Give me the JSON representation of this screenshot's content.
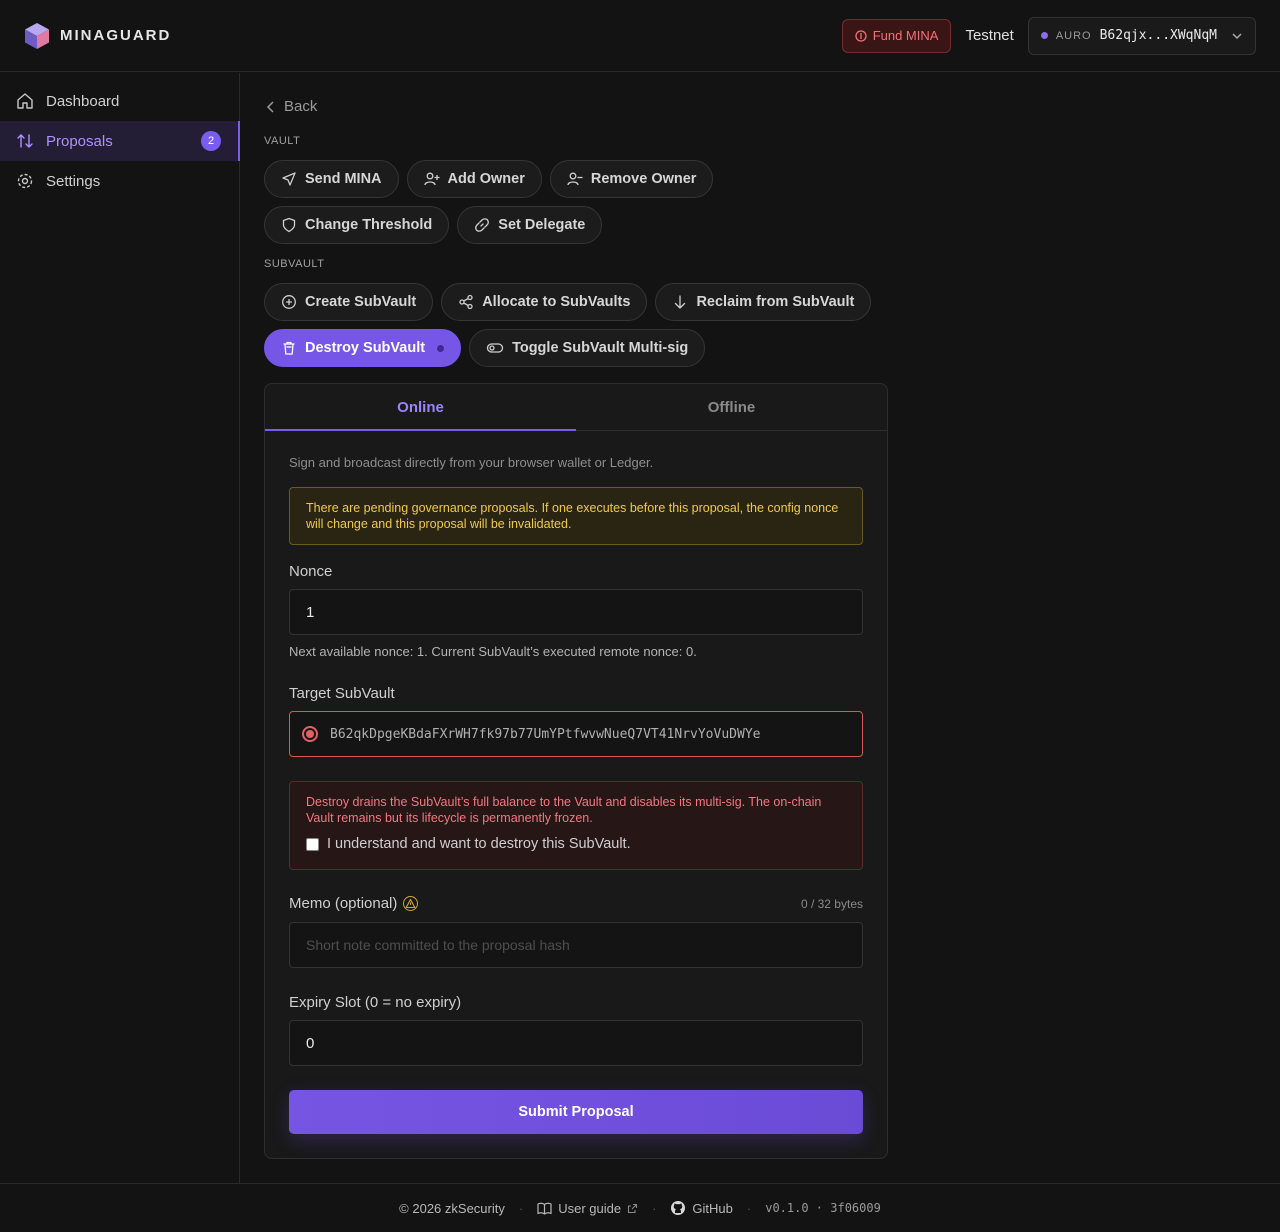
{
  "header": {
    "brand": "MINAGUARD",
    "fund_label": "Fund MINA",
    "network": "Testnet",
    "wallet_tag": "AURO",
    "wallet_address": "B62qjx...XWqNqM"
  },
  "sidebar": {
    "items": [
      {
        "label": "Dashboard"
      },
      {
        "label": "Proposals",
        "badge": "2"
      },
      {
        "label": "Settings"
      }
    ]
  },
  "main": {
    "back_label": "Back",
    "vault_section": "VAULT",
    "vault_actions": [
      "Send MINA",
      "Add Owner",
      "Remove Owner",
      "Change Threshold",
      "Set Delegate"
    ],
    "subvault_section": "SUBVAULT",
    "subvault_actions": [
      "Create SubVault",
      "Allocate to SubVaults",
      "Reclaim from SubVault",
      "Destroy SubVault",
      "Toggle SubVault Multi-sig"
    ]
  },
  "form": {
    "tabs": [
      "Online",
      "Offline"
    ],
    "hint": "Sign and broadcast directly from your browser wallet or Ledger.",
    "pending_warning": "There are pending governance proposals. If one executes before this proposal, the config nonce will change and this proposal will be invalidated.",
    "nonce_label": "Nonce",
    "nonce_value": "1",
    "nonce_hint": "Next available nonce: 1. Current SubVault’s executed remote nonce: 0.",
    "target_label": "Target SubVault",
    "target_value": "B62qkDpgeKBdaFXrWH7fk97b77UmYPtfwvwNueQ7VT41NrvYoVuDWYe",
    "destroy_warning": "Destroy drains the SubVault’s full balance to the Vault and disables its multi-sig. The on-chain Vault remains but its lifecycle is permanently frozen.",
    "confirm_label": "I understand and want to destroy this SubVault.",
    "memo_label": "Memo (optional)",
    "memo_bytes": "0 / 32 bytes",
    "memo_placeholder": "Short note committed to the proposal hash",
    "expiry_label": "Expiry Slot (0 = no expiry)",
    "expiry_value": "0",
    "submit_label": "Submit Proposal"
  },
  "footer": {
    "copyright": "© 2026 zkSecurity",
    "guide": "User guide",
    "github": "GitHub",
    "version": "v0.1.0 · 3f06009"
  },
  "colors": {
    "accent": "#7b5cf0",
    "danger": "#e36066",
    "warning": "#f2c94c"
  }
}
